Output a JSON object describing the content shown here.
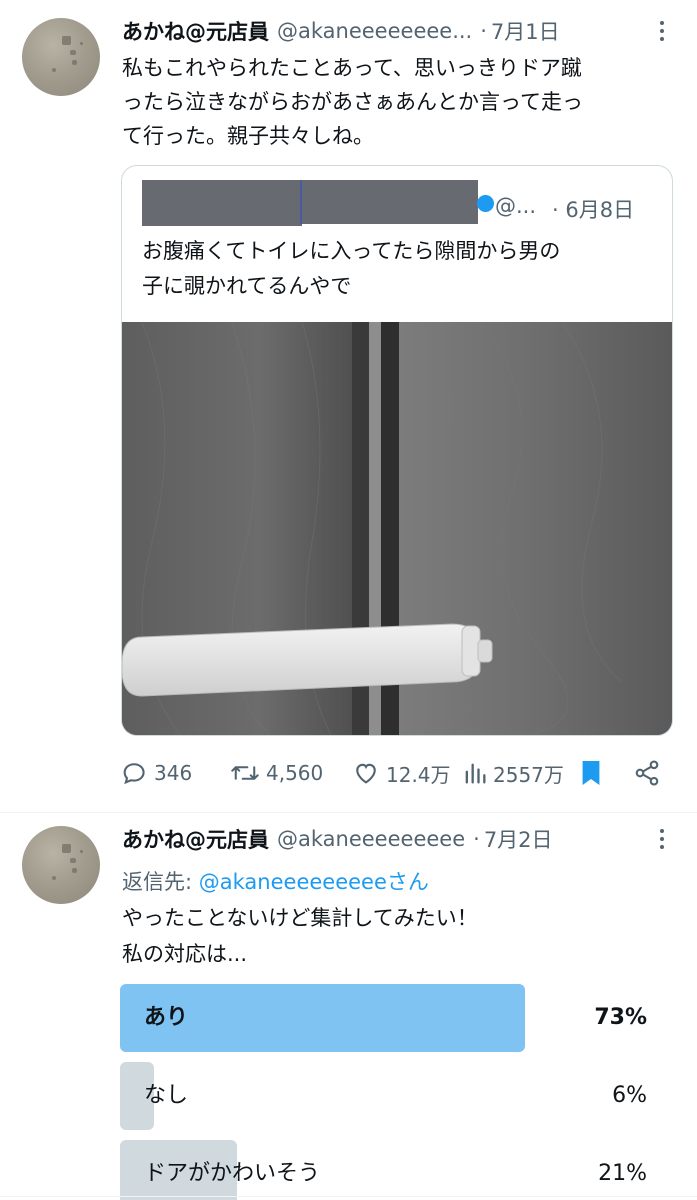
{
  "tweet1": {
    "name": "あかね@元店員",
    "handle": "@akaneeeeeeee...",
    "sep": "·",
    "date": "7月1日",
    "lines": [
      "私もこれやられたことあって、思いっきりドア蹴",
      "ったら泣きながらおがあさぁあんとか言って走っ",
      "て行った。親子共々しね。"
    ],
    "icons": {
      "more": "more-vertical-icon",
      "avatar": "avatar-image"
    }
  },
  "quote": {
    "handle": "@...",
    "sep": "·",
    "date": "6月8日",
    "lines": [
      "お腹痛くてトイレに入ってたら隙間から男の",
      "子に覗かれてるんやで"
    ],
    "icons": {
      "verified": "verified-badge-icon",
      "image": "toilet-door-lock-photo"
    }
  },
  "actions": {
    "replies": "346",
    "retweets": "4,560",
    "likes": "12.4万",
    "views": "2557万",
    "icons": [
      "reply-icon",
      "retweet-icon",
      "like-icon",
      "views-icon",
      "bookmark-icon",
      "share-icon"
    ],
    "colors": {
      "muted": "#536471",
      "bookmark": "#1d9bf0"
    }
  },
  "tweet2": {
    "name": "あかね@元店員",
    "handle": "@akaneeeeeeeee",
    "sep": "·",
    "date": "7月2日",
    "reply_label": "返信先: ",
    "reply_to": "@akaneeeeeeeeeさん",
    "lines": [
      "やったことないけど集計してみたい！",
      "私の対応は..."
    ]
  },
  "poll": {
    "options": [
      {
        "label": "あり",
        "percent": "73%",
        "fraction": 0.73,
        "winner": true
      },
      {
        "label": "なし",
        "percent": "6%",
        "fraction": 0.06,
        "winner": false
      },
      {
        "label": "ドアがかわいそう",
        "percent": "21%",
        "fraction": 0.21,
        "winner": false
      }
    ],
    "colors": {
      "winner": "#7fc3f2",
      "other": "#cfd9de"
    }
  }
}
